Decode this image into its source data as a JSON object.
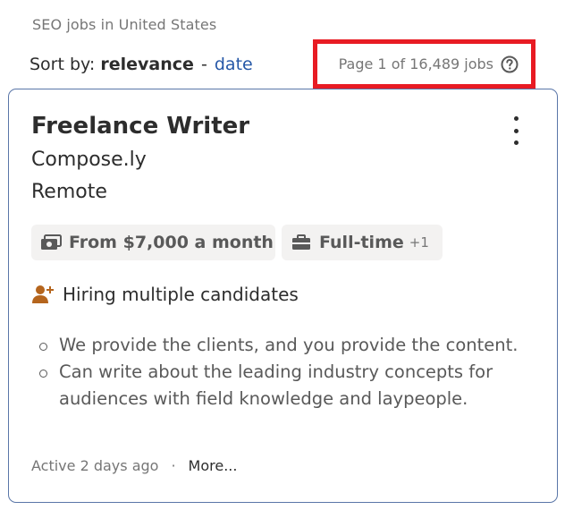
{
  "header": {
    "search_summary": "SEO jobs in United States",
    "sort_prefix": "Sort by:",
    "sort_active": "relevance",
    "sort_separator": "-",
    "sort_link": "date",
    "page_count": "Page 1 of 16,489 jobs"
  },
  "job": {
    "title": "Freelance Writer",
    "company": "Compose.ly",
    "location": "Remote",
    "salary_tag": "From $7,000 a month",
    "type_tag": "Full-time",
    "type_tag_extra": "+1",
    "hiring_note": "Hiring multiple candidates",
    "snippet": [
      "We provide the clients, and you provide the content.",
      "Can write about the leading industry concepts for audiences with field knowledge and laypeople."
    ],
    "active": "Active 2 days ago",
    "dot": "·",
    "more": "More..."
  },
  "colors": {
    "highlight_border": "#e81b23",
    "card_border": "#5a76a8",
    "link": "#2557a7",
    "hiring_icon": "#b5651d"
  },
  "icons": {
    "help": "question-circle-icon",
    "salary": "money-bill-icon",
    "job_type": "briefcase-icon",
    "hiring": "person-add-icon",
    "menu": "kebab-menu-icon"
  }
}
